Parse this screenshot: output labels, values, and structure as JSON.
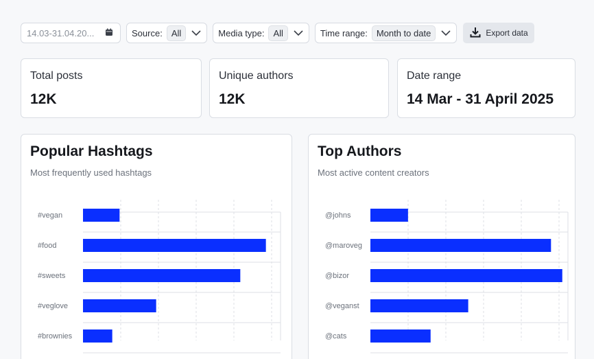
{
  "filters": {
    "date_value": "14.03-31.04.20...",
    "source_label": "Source:",
    "source_value": "All",
    "media_label": "Media type:",
    "media_value": "All",
    "time_label": "Time range:",
    "time_value": "Month to date",
    "export_label": "Export data"
  },
  "stats": [
    {
      "label": "Total posts",
      "value": "12K"
    },
    {
      "label": "Unique authors",
      "value": "12K"
    },
    {
      "label": "Date range",
      "value": "14 Mar - 31 April 2025"
    }
  ],
  "colors": {
    "bar": "#0a2fff",
    "grid": "#dcdfe4"
  },
  "chart_data": [
    {
      "type": "bar",
      "orientation": "horizontal",
      "title": "Popular Hashtags",
      "subtitle": "Most frequently used hashtags",
      "categories": [
        "#vegan",
        "#food",
        "#sweets",
        "#veglove",
        "#brownies"
      ],
      "values": [
        20,
        100,
        86,
        40,
        16
      ],
      "xlim": [
        0,
        108
      ],
      "grid": true
    },
    {
      "type": "bar",
      "orientation": "horizontal",
      "title": "Top Authors",
      "subtitle": "Most active content creators",
      "categories": [
        "@johns",
        "@maroveg",
        "@bizor",
        "@veganst",
        "@cats"
      ],
      "values": [
        20,
        96,
        102,
        52,
        32
      ],
      "xlim": [
        0,
        105
      ],
      "grid": true
    }
  ]
}
